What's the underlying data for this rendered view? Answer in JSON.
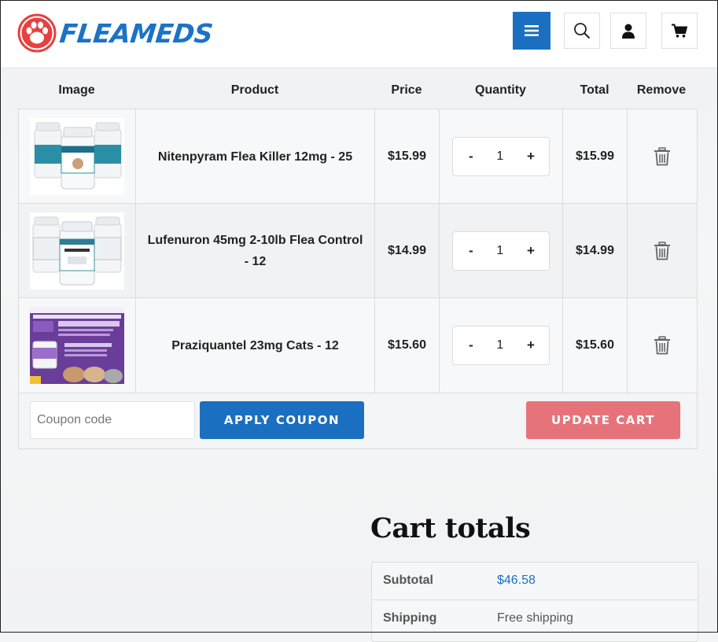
{
  "brand": {
    "name": "FLEAMEDS"
  },
  "header": {
    "menu_icon": "hamburger-icon",
    "search_icon": "search-icon",
    "account_icon": "user-icon",
    "cart_icon": "cart-icon"
  },
  "table": {
    "headers": [
      "Image",
      "Product",
      "Price",
      "Quantity",
      "Total",
      "Remove"
    ],
    "rows": [
      {
        "product": "Nitenpyram Flea Killer 12mg - 25",
        "price": "$15.99",
        "minus": "-",
        "qty": "1",
        "plus": "+",
        "total": "$15.99",
        "remove_icon": "trash-icon"
      },
      {
        "product": "Lufenuron 45mg 2-10lb Flea Control - 12",
        "price": "$14.99",
        "minus": "-",
        "qty": "1",
        "plus": "+",
        "total": "$14.99",
        "remove_icon": "trash-icon"
      },
      {
        "product": "Praziquantel 23mg Cats - 12",
        "price": "$15.60",
        "minus": "-",
        "qty": "1",
        "plus": "+",
        "total": "$15.60",
        "remove_icon": "trash-icon"
      }
    ]
  },
  "actions": {
    "coupon_placeholder": "Coupon code",
    "apply_label": "APPLY COUPON",
    "update_label": "UPDATE CART"
  },
  "totals": {
    "title": "Cart totals",
    "subtotal_label": "Subtotal",
    "subtotal_value": "$46.58",
    "shipping_label": "Shipping",
    "shipping_value": "Free shipping"
  },
  "colors": {
    "primary": "#1b6fc0",
    "update": "#e7737a",
    "logo_red": "#e8403f"
  }
}
